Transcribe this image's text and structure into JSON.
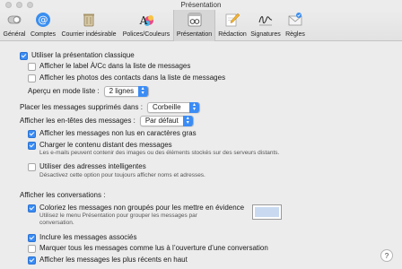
{
  "window": {
    "title": "Présentation"
  },
  "toolbar": {
    "items": [
      {
        "label": "Général",
        "icon": "switch-icon"
      },
      {
        "label": "Comptes",
        "icon": "at-icon"
      },
      {
        "label": "Courrier indésirable",
        "icon": "trash-icon"
      },
      {
        "label": "Polices/Couleurs",
        "icon": "fonts-icon"
      },
      {
        "label": "Présentation",
        "icon": "eyeglasses-window-icon"
      },
      {
        "label": "Rédaction",
        "icon": "pencil-icon"
      },
      {
        "label": "Signatures",
        "icon": "signature-icon"
      },
      {
        "label": "Règles",
        "icon": "rules-envelope-icon"
      }
    ]
  },
  "list": {
    "classic_label": "Utiliser la présentation classique",
    "show_to_cc_label": "Afficher le label À/Cc dans la liste de messages",
    "show_photos_label": "Afficher les photos des contacts dans la liste de messages",
    "preview_label": "Aperçu en mode liste :",
    "preview_value": "2 lignes"
  },
  "deleted": {
    "label": "Placer les messages supprimés dans :",
    "value": "Corbeille"
  },
  "headers": {
    "label": "Afficher les en-têtes des messages :",
    "value": "Par défaut"
  },
  "options": {
    "unread_bold_label": "Afficher les messages non lus en caractères gras",
    "remote_content_label": "Charger le contenu distant des messages",
    "remote_content_note": "Les e-mails peuvent contenir des images ou des éléments stockés sur des serveurs distants.",
    "smart_addresses_label": "Utiliser des adresses intelligentes",
    "smart_addresses_note": "Désactivez cette option pour toujours afficher noms et adresses."
  },
  "conversations": {
    "heading": "Afficher les conversations :",
    "highlight_label": "Coloriez les messages non groupés pour les mettre en évidence",
    "highlight_note": "Utilisez le menu Présentation pour grouper les messages par conversation.",
    "highlight_color": "#c9daf0",
    "include_related_label": "Inclure les messages associés",
    "mark_read_label": "Marquer tous les messages comme lus à l’ouverture d’une conversation",
    "most_recent_top_label": "Afficher les messages les plus récents en haut"
  },
  "help_label": "?"
}
